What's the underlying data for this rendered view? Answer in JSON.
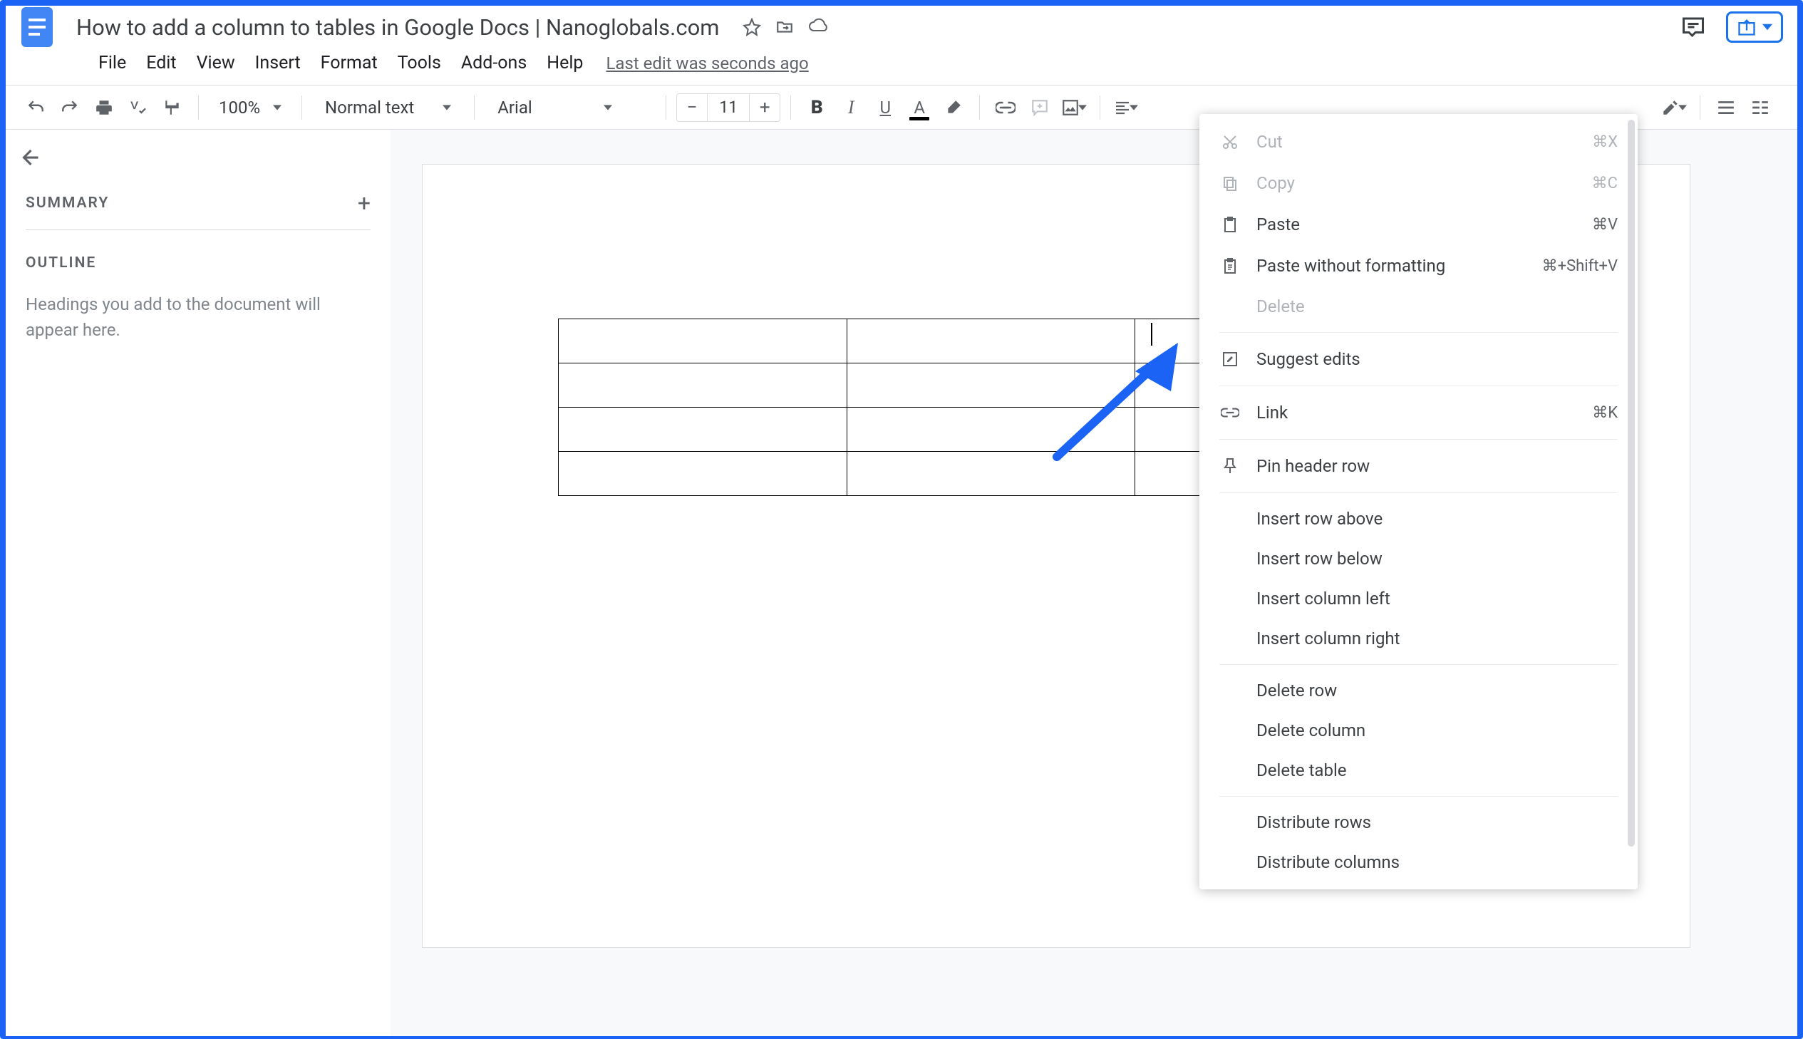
{
  "doc": {
    "title": "How to add a column to tables in Google Docs | Nanoglobals.com",
    "last_edit": "Last edit was seconds ago"
  },
  "menus": {
    "file": "File",
    "edit": "Edit",
    "view": "View",
    "insert": "Insert",
    "format": "Format",
    "tools": "Tools",
    "addons": "Add-ons",
    "help": "Help"
  },
  "toolbar": {
    "zoom": "100%",
    "style": "Normal text",
    "font": "Arial",
    "fontsize": "11"
  },
  "sidebar": {
    "summary": "SUMMARY",
    "outline": "OUTLINE",
    "outline_empty": "Headings you add to the document will appear here."
  },
  "context_menu": {
    "cut": "Cut",
    "cut_sc": "⌘X",
    "copy": "Copy",
    "copy_sc": "⌘C",
    "paste": "Paste",
    "paste_sc": "⌘V",
    "paste_plain": "Paste without formatting",
    "paste_plain_sc": "⌘+Shift+V",
    "delete": "Delete",
    "suggest": "Suggest edits",
    "link": "Link",
    "link_sc": "⌘K",
    "pin": "Pin header row",
    "ins_row_above": "Insert row above",
    "ins_row_below": "Insert row below",
    "ins_col_left": "Insert column left",
    "ins_col_right": "Insert column right",
    "del_row": "Delete row",
    "del_col": "Delete column",
    "del_table": "Delete table",
    "dist_rows": "Distribute rows",
    "dist_cols": "Distribute columns"
  }
}
